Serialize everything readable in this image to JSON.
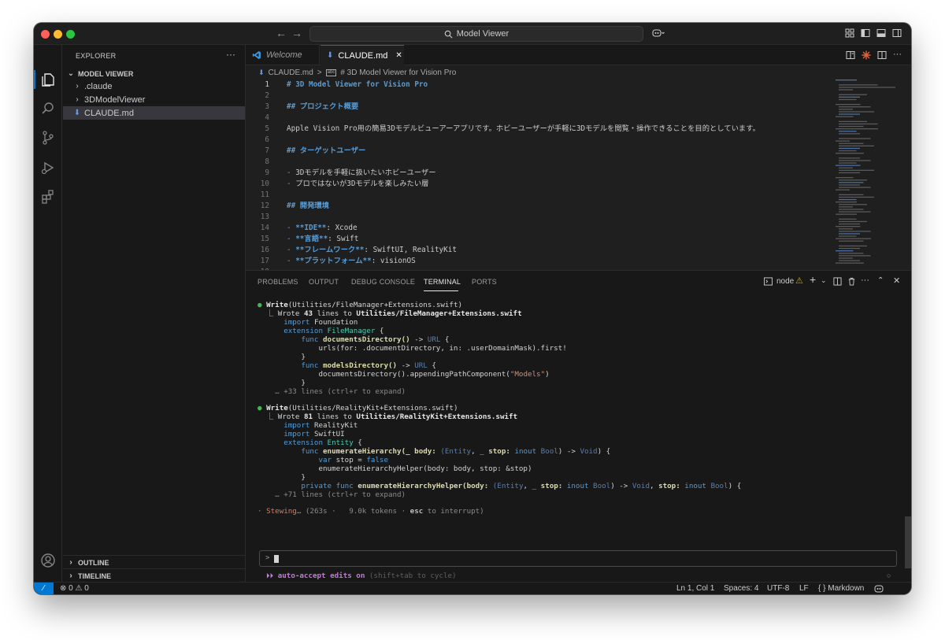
{
  "window": {
    "search_text": "Model Viewer"
  },
  "sidebar": {
    "title": "EXPLORER",
    "more": "···",
    "project": "MODEL VIEWER",
    "items": [
      {
        "label": ".claude",
        "type": "folder"
      },
      {
        "label": "3DModelViewer",
        "type": "folder"
      },
      {
        "label": "CLAUDE.md",
        "type": "file",
        "selected": true
      }
    ],
    "outline": "OUTLINE",
    "timeline": "TIMELINE"
  },
  "tabs": [
    {
      "label": "Welcome",
      "active": false
    },
    {
      "label": "CLAUDE.md",
      "active": true,
      "close": "✕"
    }
  ],
  "breadcrumb": {
    "file": "CLAUDE.md",
    "sep": ">",
    "symbol": "# 3D Model Viewer for Vision Pro"
  },
  "editor": {
    "lines": [
      {
        "n": "1",
        "text": "# 3D Model Viewer for Vision Pro"
      },
      {
        "n": "2",
        "text": ""
      },
      {
        "n": "3",
        "text": "## プロジェクト概要"
      },
      {
        "n": "4",
        "text": ""
      },
      {
        "n": "5",
        "text": "Apple Vision Pro用の簡易3Dモデルビューアーアプリです。ホビーユーザーが手軽に3Dモデルを閲覧・操作できることを目的としています。"
      },
      {
        "n": "6",
        "text": ""
      },
      {
        "n": "7",
        "text": "## ターゲットユーザー"
      },
      {
        "n": "8",
        "text": ""
      },
      {
        "n": "9",
        "text": "- 3Dモデルを手軽に扱いたいホビーユーザー"
      },
      {
        "n": "10",
        "text": "- プロではないが3Dモデルを楽しみたい層"
      },
      {
        "n": "11",
        "text": ""
      },
      {
        "n": "12",
        "text": "## 開発環境"
      },
      {
        "n": "13",
        "text": ""
      },
      {
        "n": "14",
        "bold": "**IDE**",
        "rest": ": Xcode"
      },
      {
        "n": "15",
        "bold": "**言語**",
        "rest": ": Swift"
      },
      {
        "n": "16",
        "bold": "**フレームワーク**",
        "rest": ": SwiftUI, RealityKit"
      },
      {
        "n": "17",
        "bold": "**プラットフォーム**",
        "rest": ": visionOS"
      },
      {
        "n": "18",
        "text": ""
      }
    ]
  },
  "panel": {
    "tabs": [
      "PROBLEMS",
      "OUTPUT",
      "DEBUG CONSOLE",
      "TERMINAL",
      "PORTS"
    ],
    "active_tab": "TERMINAL",
    "terminal_name": "node",
    "add": "+",
    "more": "···"
  },
  "terminal": {
    "write1": {
      "tool": "Write",
      "arg": "(Utilities/FileManager+Extensions.swift)",
      "result_prefix": "⎿ Wrote ",
      "count": "43",
      "result_mid": " lines to ",
      "path": "Utilities/FileManager+Extensions.swift",
      "code": {
        "import": "import",
        "module": " Foundation",
        "ext": "extension",
        "ext_type": " FileManager",
        "brace_open": " {",
        "func": "func",
        "fn1": " documentsDirectory()",
        "arrow": " ->",
        "url": " URL",
        "l5": "urls(for: .documentDirectory, in: .userDomainMask).first!",
        "close": "}",
        "fn2": " modelsDirectory()",
        "l8a": "documentsDirectory().appendingPathComponent(",
        "l8s": "\"Models\"",
        "l8b": ")",
        "more": "… +33 lines (ctrl+r to expand)"
      }
    },
    "write2": {
      "tool": "Write",
      "arg": "(Utilities/RealityKit+Extensions.swift)",
      "result_prefix": "⎿ Wrote ",
      "count": "81",
      "result_mid": " lines to ",
      "path": "Utilities/RealityKit+Extensions.swift",
      "code": {
        "import": "import",
        "m1": " RealityKit",
        "m2": " SwiftUI",
        "ext": "extension",
        "ext_type": " Entity",
        "func": "func",
        "fn1": " enumerateHierarchy(_ body:",
        "p1": " (Entity",
        "p2": ", _ ",
        "stop": "stop:",
        "inout": " inout",
        "bool": " Bool",
        "p3": ") ->",
        "void": " Void",
        "p4": ") {",
        "var": "var",
        "var_name": " stop = ",
        "false": "false",
        "helper_call": "enumerateHierarchyHelper(body: body, stop: &stop)",
        "close": "}",
        "private": "private",
        "fn2": " enumerateHierarchyHelper(body:",
        "p5": ") ->",
        "p6": ", ",
        "p7": ") {",
        "more": "… +71 lines (ctrl+r to expand)"
      }
    },
    "status": {
      "spinner": "·",
      "word": "Stewing…",
      "detail": " (263s ·   9.0k tokens · ",
      "esc": "esc",
      "tail": " to interrupt)"
    },
    "prompt": ">",
    "mode": {
      "arrows": "⏵⏵",
      "label": " auto-accept edits on",
      "hint": " (shift+tab to cycle)"
    }
  },
  "statusbar": {
    "remote": "⁄",
    "problems": "⊗ 0 ⚠ 0",
    "position": "Ln 1, Col 1",
    "spaces": "Spaces: 4",
    "encoding": "UTF-8",
    "eol": "LF",
    "language": "{ } Markdown"
  }
}
